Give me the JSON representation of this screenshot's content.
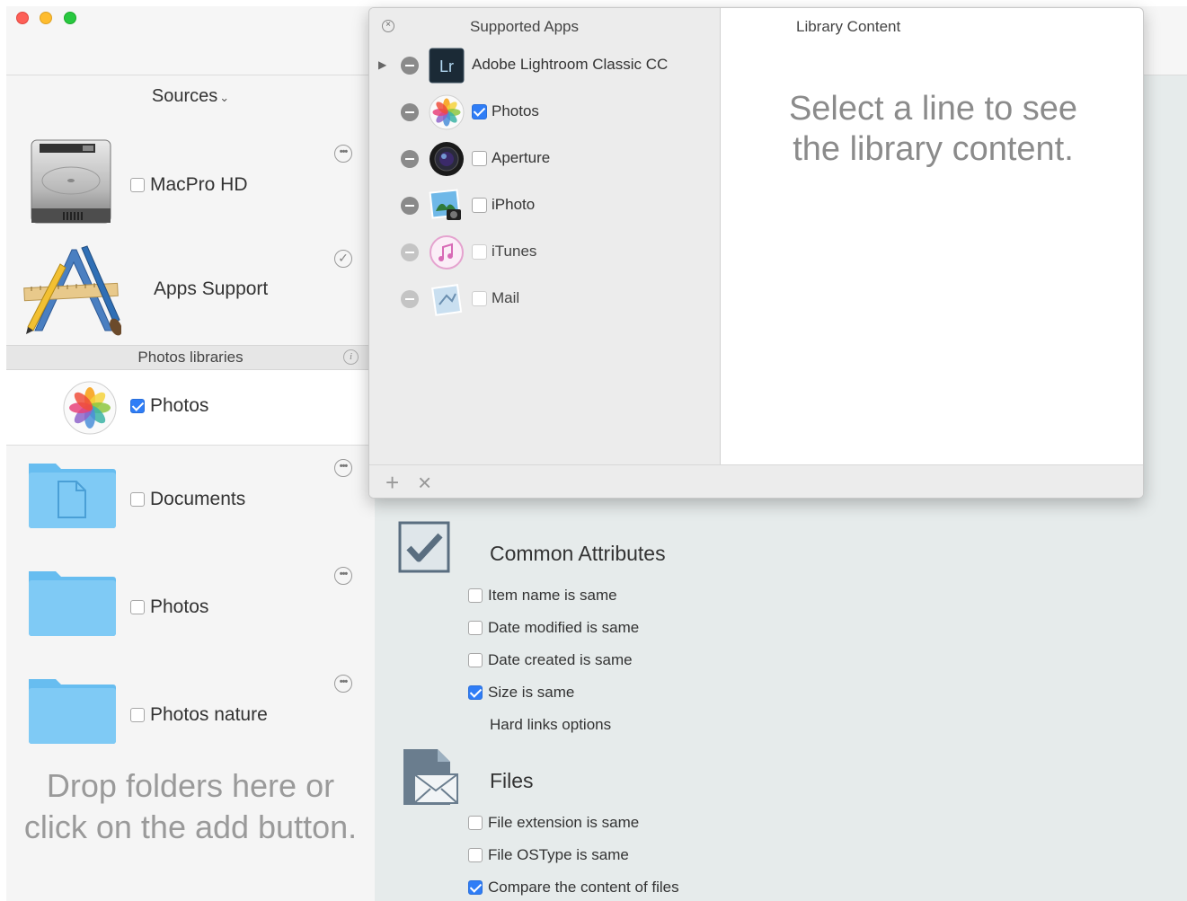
{
  "window": {
    "sidebar": {
      "sources_header": "Sources",
      "items": {
        "macpro": {
          "label": "MacPro HD",
          "checked": false
        },
        "apps_support": {
          "label": "Apps Support"
        },
        "photos_lib": {
          "label": "Photos",
          "checked": true
        },
        "documents": {
          "label": "Documents",
          "checked": false
        },
        "photos_folder": {
          "label": "Photos",
          "checked": false
        },
        "photos_nature": {
          "label": "Photos nature",
          "checked": false
        }
      },
      "photos_libraries_header": "Photos libraries",
      "drop_text_line1": "Drop folders here or",
      "drop_text_line2": "click on the add button."
    },
    "popover": {
      "supported_apps_title": "Supported Apps",
      "library_content_title": "Library Content",
      "placeholder_line1": "Select a line to see",
      "placeholder_line2": "the library content.",
      "apps": [
        {
          "label": "Adobe Lightroom Classic CC",
          "icon": "lightroom-icon",
          "checkbox": false,
          "disclosure": true
        },
        {
          "label": "Photos",
          "icon": "photos-icon",
          "checkbox": true,
          "checked": true
        },
        {
          "label": "Aperture",
          "icon": "aperture-icon",
          "checkbox": true,
          "checked": false
        },
        {
          "label": "iPhoto",
          "icon": "iphoto-icon",
          "checkbox": true,
          "checked": false
        },
        {
          "label": "iTunes",
          "icon": "itunes-icon",
          "checkbox": true,
          "checked": false,
          "dim": true
        },
        {
          "label": "Mail",
          "icon": "mail-icon",
          "checkbox": true,
          "checked": false,
          "dim": true
        }
      ],
      "footer_add": "+",
      "footer_remove": "×",
      "lightroom_badge": "Lr"
    },
    "main": {
      "common_attributes_title": "Common Attributes",
      "common_options": [
        {
          "label": "Item name is same",
          "checked": false
        },
        {
          "label": "Date modified is same",
          "checked": false
        },
        {
          "label": "Date created is same",
          "checked": false
        },
        {
          "label": "Size is same",
          "checked": true
        }
      ],
      "hard_links_label": "Hard links options",
      "files_title": "Files",
      "file_options": [
        {
          "label": "File extension is same",
          "checked": false
        },
        {
          "label": "File OSType is same",
          "checked": false
        },
        {
          "label": "Compare the content of files",
          "checked": true
        }
      ]
    },
    "colors": {
      "accent": "#2f7df6",
      "folder_blue": "#5fb8f0",
      "main_bg": "#e6ebeb"
    }
  }
}
